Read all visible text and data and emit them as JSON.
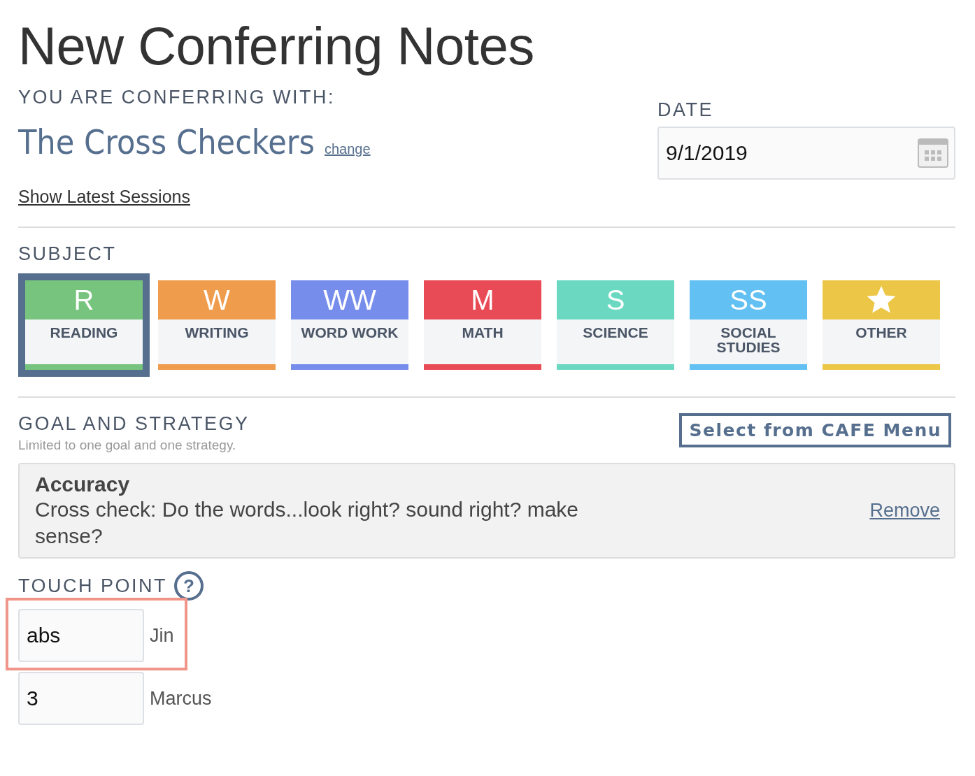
{
  "title": "New Conferring Notes",
  "conferring": {
    "label": "YOU ARE CONFERRING WITH:",
    "group": "The Cross Checkers",
    "change_link": "change"
  },
  "date": {
    "label": "DATE",
    "value": "9/1/2019"
  },
  "show_sessions_link": "Show Latest Sessions",
  "subject": {
    "label": "SUBJECT",
    "items": [
      {
        "kind": "letters",
        "letters": "R",
        "label": "READING",
        "color": "#77c47e",
        "selected": true
      },
      {
        "kind": "letters",
        "letters": "W",
        "label": "WRITING",
        "color": "#ef9c4c",
        "selected": false
      },
      {
        "kind": "letters",
        "letters": "WW",
        "label": "WORD WORK",
        "color": "#778deb",
        "selected": false
      },
      {
        "kind": "letters",
        "letters": "M",
        "label": "MATH",
        "color": "#e84b56",
        "selected": false
      },
      {
        "kind": "letters",
        "letters": "S",
        "label": "SCIENCE",
        "color": "#6bd8c2",
        "selected": false
      },
      {
        "kind": "letters",
        "letters": "SS",
        "label": "SOCIAL STUDIES",
        "color": "#62c0f3",
        "selected": false
      },
      {
        "kind": "star",
        "label": "OTHER",
        "color": "#ecc646",
        "selected": false
      }
    ]
  },
  "goal": {
    "label": "GOAL AND STRATEGY",
    "hint": "Limited to one goal and one strategy.",
    "menu_button": "Select from CAFE Menu",
    "goal_title": "Accuracy",
    "strategy": "Cross check: Do the words...look right? sound right? make sense?",
    "remove_link": "Remove"
  },
  "touch_point": {
    "label": "TOUCH POINT",
    "help": "?",
    "rows": [
      {
        "value": "abs",
        "student": "Jin",
        "highlighted": true
      },
      {
        "value": "3",
        "student": "Marcus",
        "highlighted": false
      }
    ]
  }
}
